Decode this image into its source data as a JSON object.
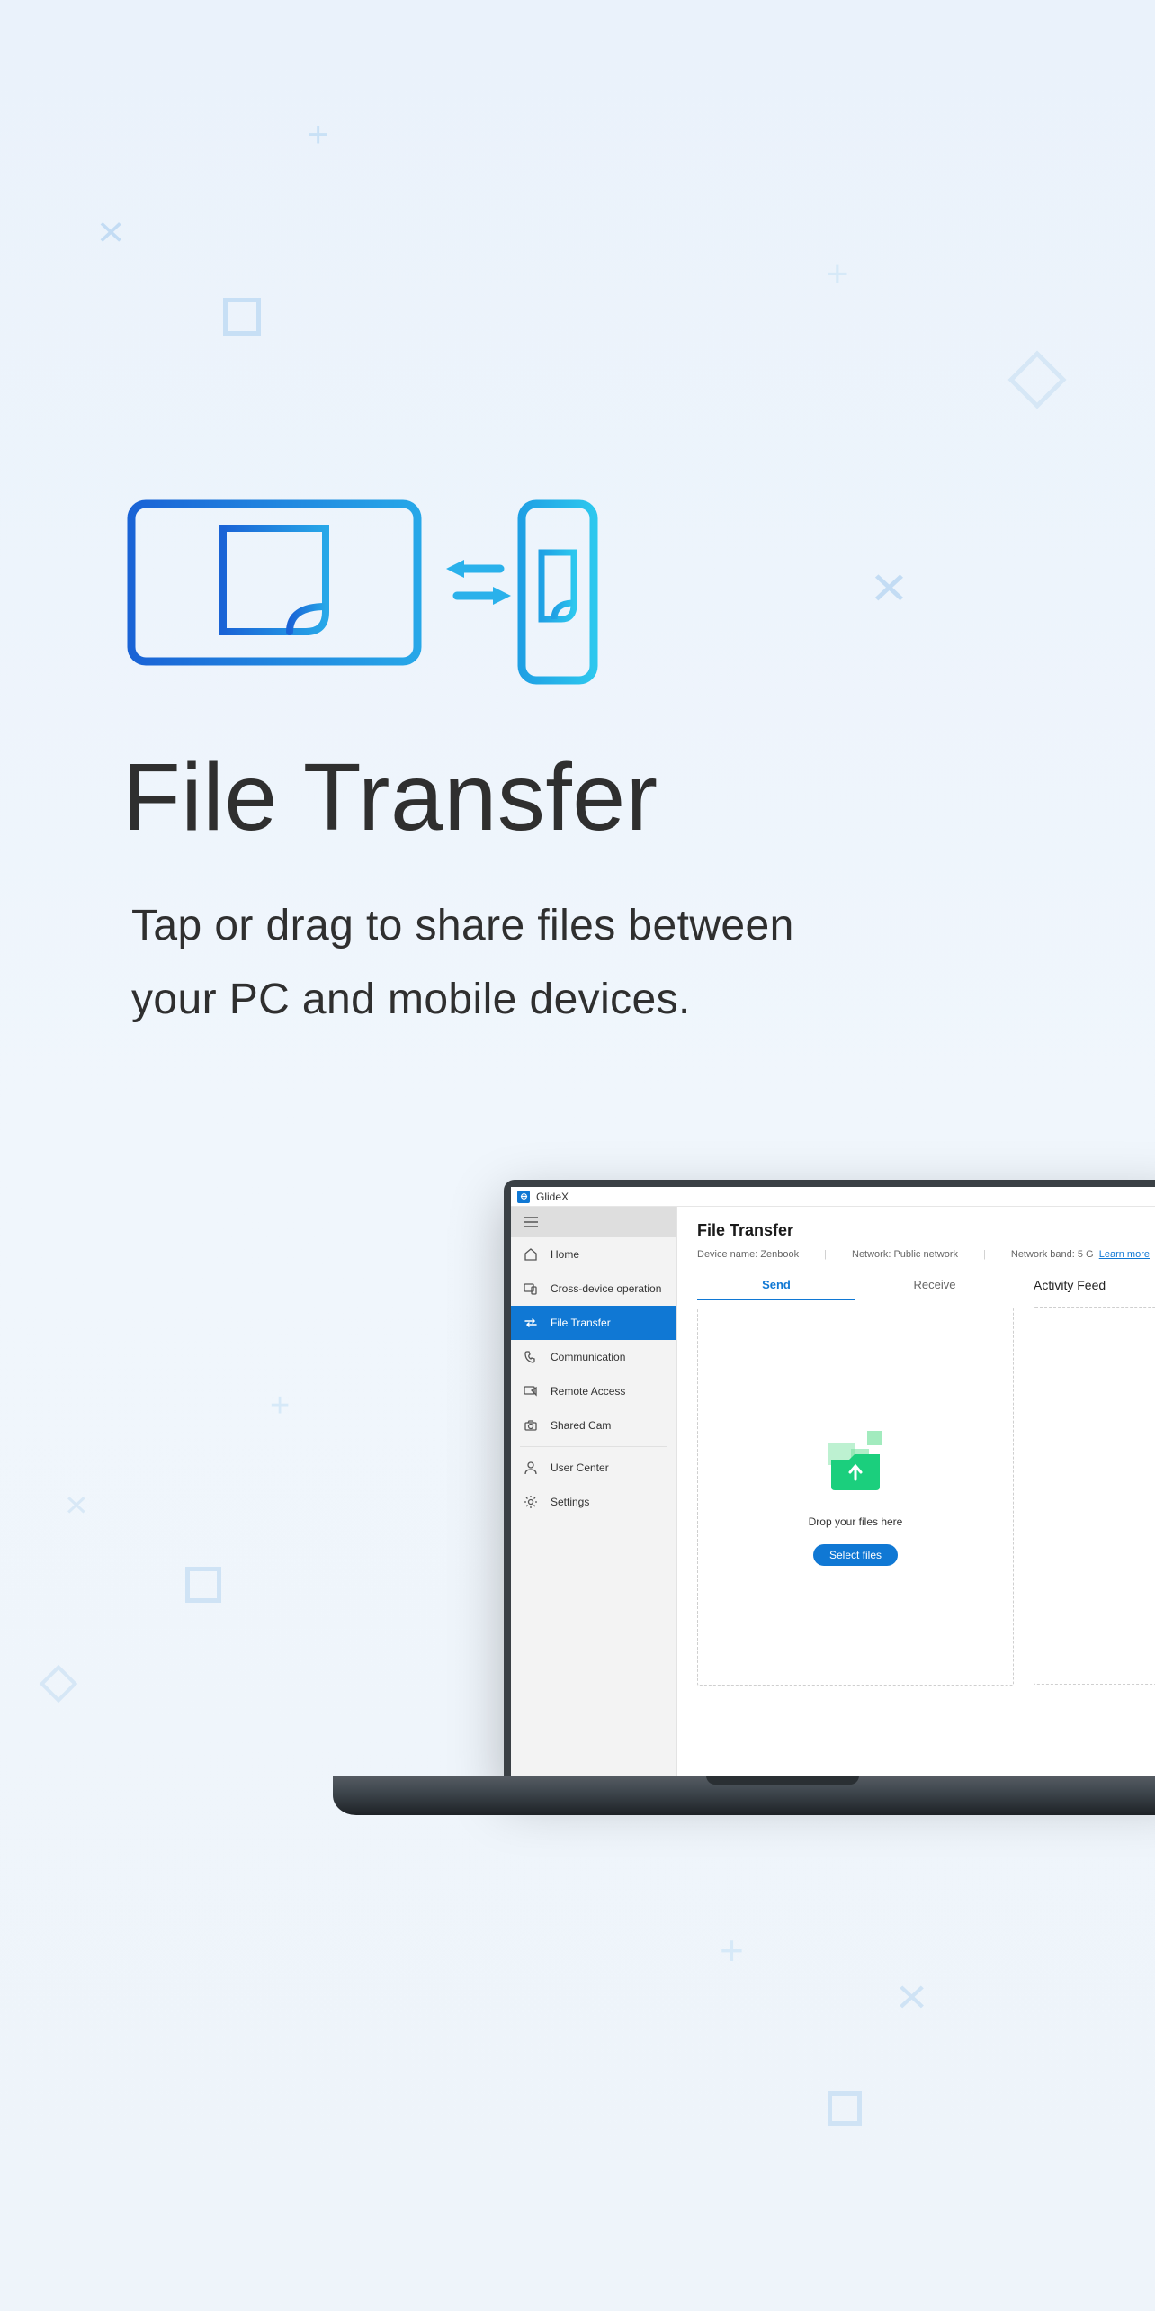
{
  "page": {
    "title": "File Transfer",
    "subtitle_line1": "Tap or drag to share files between",
    "subtitle_line2": "your PC and mobile devices."
  },
  "app": {
    "window_title": "GlideX",
    "sidebar": {
      "items": [
        {
          "label": "Home",
          "icon": "home"
        },
        {
          "label": "Cross-device operation",
          "icon": "devices"
        },
        {
          "label": "File Transfer",
          "icon": "transfer",
          "active": true
        },
        {
          "label": "Communication",
          "icon": "phone"
        },
        {
          "label": "Remote Access",
          "icon": "remote"
        },
        {
          "label": "Shared Cam",
          "icon": "camera"
        }
      ],
      "bottom_items": [
        {
          "label": "User Center",
          "icon": "user"
        },
        {
          "label": "Settings",
          "icon": "gear"
        }
      ]
    },
    "content": {
      "title": "File Transfer",
      "device_label": "Device name:",
      "device_value": "Zenbook",
      "network_label": "Network:",
      "network_value": "Public network",
      "band_label": "Network band:",
      "band_value": "5 G",
      "learn_more": "Learn more",
      "tabs": {
        "send": "Send",
        "receive": "Receive"
      },
      "dropzone_text": "Drop your files here",
      "select_button": "Select files",
      "activity_panel_title": "Activity Feed"
    }
  }
}
